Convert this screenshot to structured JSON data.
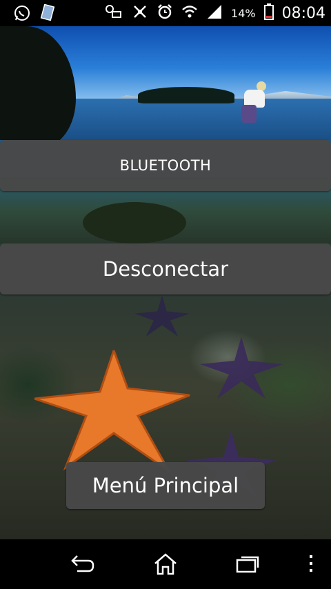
{
  "status_bar": {
    "battery_percent": "14%",
    "time": "08:04",
    "icons_left": [
      "whatsapp-icon",
      "file-icon"
    ],
    "icons_right": [
      "ptt-icon",
      "mute-icon",
      "alarm-icon",
      "wifi-icon",
      "signal-icon",
      "battery-icon"
    ]
  },
  "main": {
    "bluetooth_label": "BLUETOOTH",
    "disconnect_label": "Desconectar",
    "main_menu_label": "Menú Principal"
  },
  "nav_bar": {
    "icons": [
      "back-icon",
      "home-icon",
      "recents-icon",
      "overflow-menu-icon"
    ]
  },
  "colors": {
    "button_bg": "#484848",
    "button_text": "#ffffff",
    "status_bar_bg": "#000000",
    "nav_bar_bg": "#000000"
  }
}
